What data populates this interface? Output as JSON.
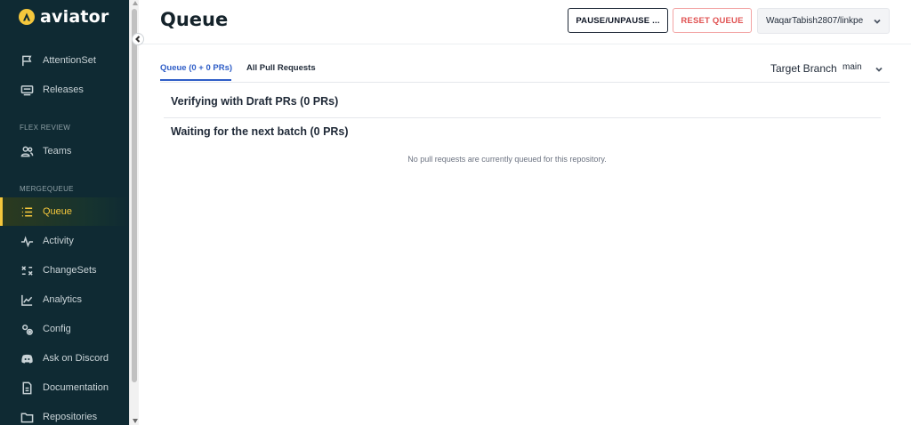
{
  "app": {
    "logo_text": "aviator",
    "brand_color": "#f5c73c",
    "sidebar_bg": "#0f2a33"
  },
  "sidebar": {
    "items": [
      {
        "label": "AttentionSet",
        "icon": "flag-icon"
      },
      {
        "label": "Releases",
        "icon": "release-icon"
      }
    ],
    "flex_section": "FLEX REVIEW",
    "flex_items": [
      {
        "label": "Teams",
        "icon": "teams-icon"
      }
    ],
    "mq_section": "MERGEQUEUE",
    "mq_items": [
      {
        "label": "Queue",
        "icon": "list-icon",
        "active": true
      },
      {
        "label": "Activity",
        "icon": "activity-icon"
      },
      {
        "label": "ChangeSets",
        "icon": "changesets-icon"
      },
      {
        "label": "Analytics",
        "icon": "analytics-icon"
      },
      {
        "label": "Config",
        "icon": "config-icon"
      },
      {
        "label": "Ask on Discord",
        "icon": "discord-icon"
      },
      {
        "label": "Documentation",
        "icon": "document-icon"
      },
      {
        "label": "Repositories",
        "icon": "folder-icon"
      }
    ]
  },
  "header": {
    "title": "Queue",
    "pause_label": "PAUSE/UNPAUSE ...",
    "reset_label": "RESET QUEUE",
    "repo_value": "WaqarTabish2807/linkpe"
  },
  "tabs": {
    "queue_label": "Queue (0 + 0 PRs)",
    "all_label": "All Pull Requests",
    "target_branch_label": "Target Branch",
    "target_branch_value": "main"
  },
  "content": {
    "verifying_title": "Verifying with Draft PRs (0 PRs)",
    "waiting_title": "Waiting for the next batch (0 PRs)",
    "empty_message": "No pull requests are currently queued for this repository."
  }
}
